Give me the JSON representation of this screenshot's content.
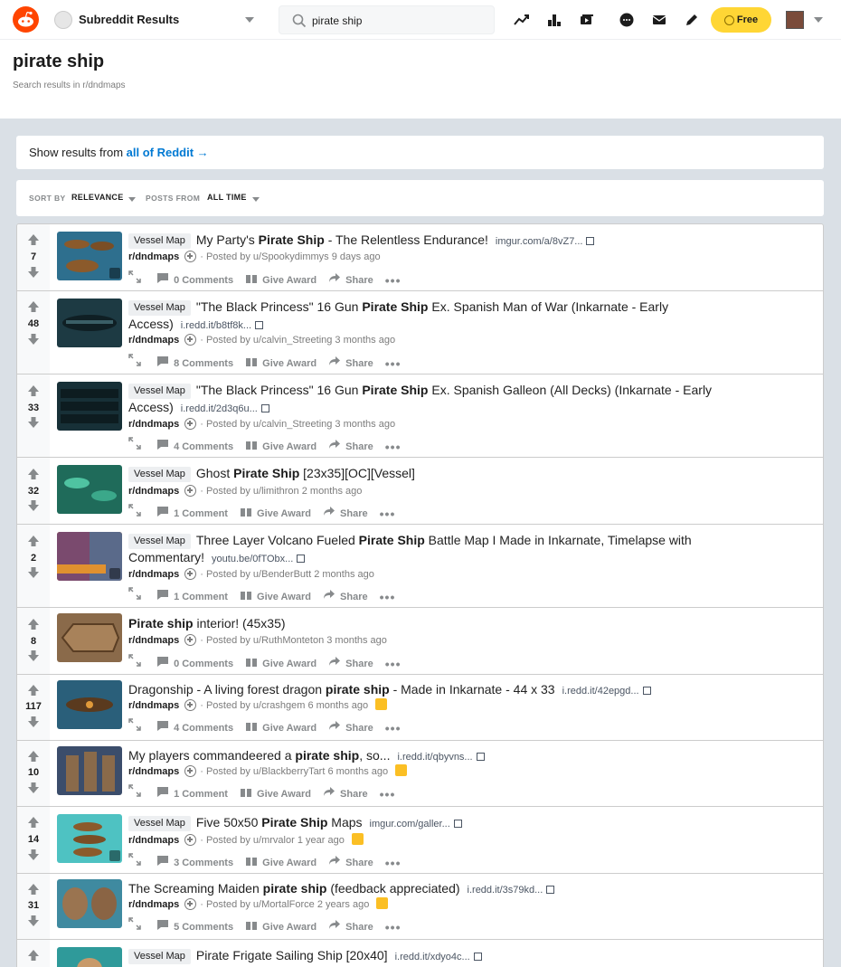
{
  "nav": {
    "community_label": "Subreddit Results",
    "search_value": "pirate ship",
    "search_placeholder": "Search",
    "free_label": "Free"
  },
  "header": {
    "title": "pirate ship",
    "subtitle": "Search results in r/dndmaps"
  },
  "show_results": {
    "prefix": "Show results from",
    "link": "all of Reddit →"
  },
  "sort": {
    "sort_by_label": "SORT BY",
    "sort_by_value": "RELEVANCE",
    "posts_from_label": "POSTS FROM",
    "posts_from_value": "ALL TIME"
  },
  "posts": [
    {
      "score": "7",
      "flair": "Vessel Map",
      "t1": "My Party's ",
      "hl": "Pirate Ship",
      "t2": " - The Relentless Endurance!",
      "domain": "imgur.com/a/8vZ7...",
      "subreddit": "r/dndmaps",
      "posted": "· Posted by u/Spookydimmys 9 days ago",
      "comments": "0 Comments",
      "award": "Give Award",
      "share": "Share",
      "thumb_color": "#2e6f8e"
    },
    {
      "score": "48",
      "flair": "Vessel Map",
      "t1": "\"The Black Princess\" 16 Gun ",
      "hl": "Pirate Ship",
      "t2": " Ex. Spanish Man of War (Inkarnate - Early Access)",
      "domain": "i.redd.it/b8tf8k...",
      "subreddit": "r/dndmaps",
      "posted": "· Posted by u/calvin_Streeting 3 months ago",
      "comments": "8 Comments",
      "award": "Give Award",
      "share": "Share",
      "thumb_color": "#1d3a43"
    },
    {
      "score": "33",
      "flair": "Vessel Map",
      "t1": "\"The Black Princess\" 16 Gun ",
      "hl": "Pirate Ship",
      "t2": " Ex. Spanish Galleon (All Decks) (Inkarnate - Early Access)",
      "domain": "i.redd.it/2d3q6u...",
      "subreddit": "r/dndmaps",
      "posted": "· Posted by u/calvin_Streeting 3 months ago",
      "comments": "4 Comments",
      "award": "Give Award",
      "share": "Share",
      "thumb_color": "#173037"
    },
    {
      "score": "32",
      "flair": "Vessel Map",
      "t1": "Ghost ",
      "hl": "Pirate Ship",
      "t2": " [23x35][OC][Vessel]",
      "domain": "",
      "subreddit": "r/dndmaps",
      "posted": "· Posted by u/limithron 2 months ago",
      "comments": "1 Comment",
      "award": "Give Award",
      "share": "Share",
      "thumb_color": "#1f6b5a"
    },
    {
      "score": "2",
      "flair": "Vessel Map",
      "t1": "Three Layer Volcano Fueled ",
      "hl": "Pirate Ship",
      "t2": " Battle Map I Made in Inkarnate, Timelapse with Commentary!",
      "domain": "youtu.be/0fTObx...",
      "subreddit": "r/dndmaps",
      "posted": "· Posted by u/BenderButt 2 months ago",
      "comments": "1 Comment",
      "award": "Give Award",
      "share": "Share",
      "thumb_color": "#c86a2a"
    },
    {
      "score": "8",
      "flair": "",
      "t1": "",
      "hl": "Pirate ship",
      "t2": " interior! (45x35)",
      "domain": "",
      "subreddit": "r/dndmaps",
      "posted": "· Posted by u/RuthMonteton 3 months ago",
      "comments": "0 Comments",
      "award": "Give Award",
      "share": "Share",
      "thumb_color": "#8a6a4a"
    },
    {
      "score": "117",
      "flair": "",
      "t1": "Dragonship - A living forest dragon ",
      "hl": "pirate ship",
      "t2": " - Made in Inkarnate - 44 x 33",
      "domain": "i.redd.it/42epgd...",
      "subreddit": "r/dndmaps",
      "posted": "· Posted by u/crashgem 6 months ago",
      "comments": "4 Comments",
      "award": "Give Award",
      "share": "Share",
      "thumb_color": "#2a5f7a"
    },
    {
      "score": "10",
      "flair": "",
      "t1": "My players commandeered a ",
      "hl": "pirate ship",
      "t2": ", so...",
      "domain": "i.redd.it/qbyvns...",
      "subreddit": "r/dndmaps",
      "posted": "· Posted by u/BlackberryTart 6 months ago",
      "comments": "1 Comment",
      "award": "Give Award",
      "share": "Share",
      "thumb_color": "#3b4d6b"
    },
    {
      "score": "14",
      "flair": "Vessel Map",
      "t1": "Five 50x50 ",
      "hl": "Pirate Ship",
      "t2": " Maps",
      "domain": "imgur.com/galler...",
      "subreddit": "r/dndmaps",
      "posted": "· Posted by u/mrvalor 1 year ago",
      "comments": "3 Comments",
      "award": "Give Award",
      "share": "Share",
      "thumb_color": "#4ec2c2"
    },
    {
      "score": "31",
      "flair": "",
      "t1": "The Screaming Maiden ",
      "hl": "pirate ship",
      "t2": " (feedback appreciated)",
      "domain": "i.redd.it/3s79kd...",
      "subreddit": "r/dndmaps",
      "posted": "· Posted by u/MortalForce 2 years ago",
      "comments": "5 Comments",
      "award": "Give Award",
      "share": "Share",
      "thumb_color": "#3f8aa0"
    },
    {
      "score": "",
      "flair": "Vessel Map",
      "t1": "Pirate Frigate Sailing Ship [20x40]",
      "hl": "",
      "t2": "",
      "domain": "i.redd.it/xdyo4c...",
      "subreddit": "",
      "posted": "",
      "comments": "",
      "award": "",
      "share": "",
      "thumb_color": "#2f9a9a"
    }
  ]
}
